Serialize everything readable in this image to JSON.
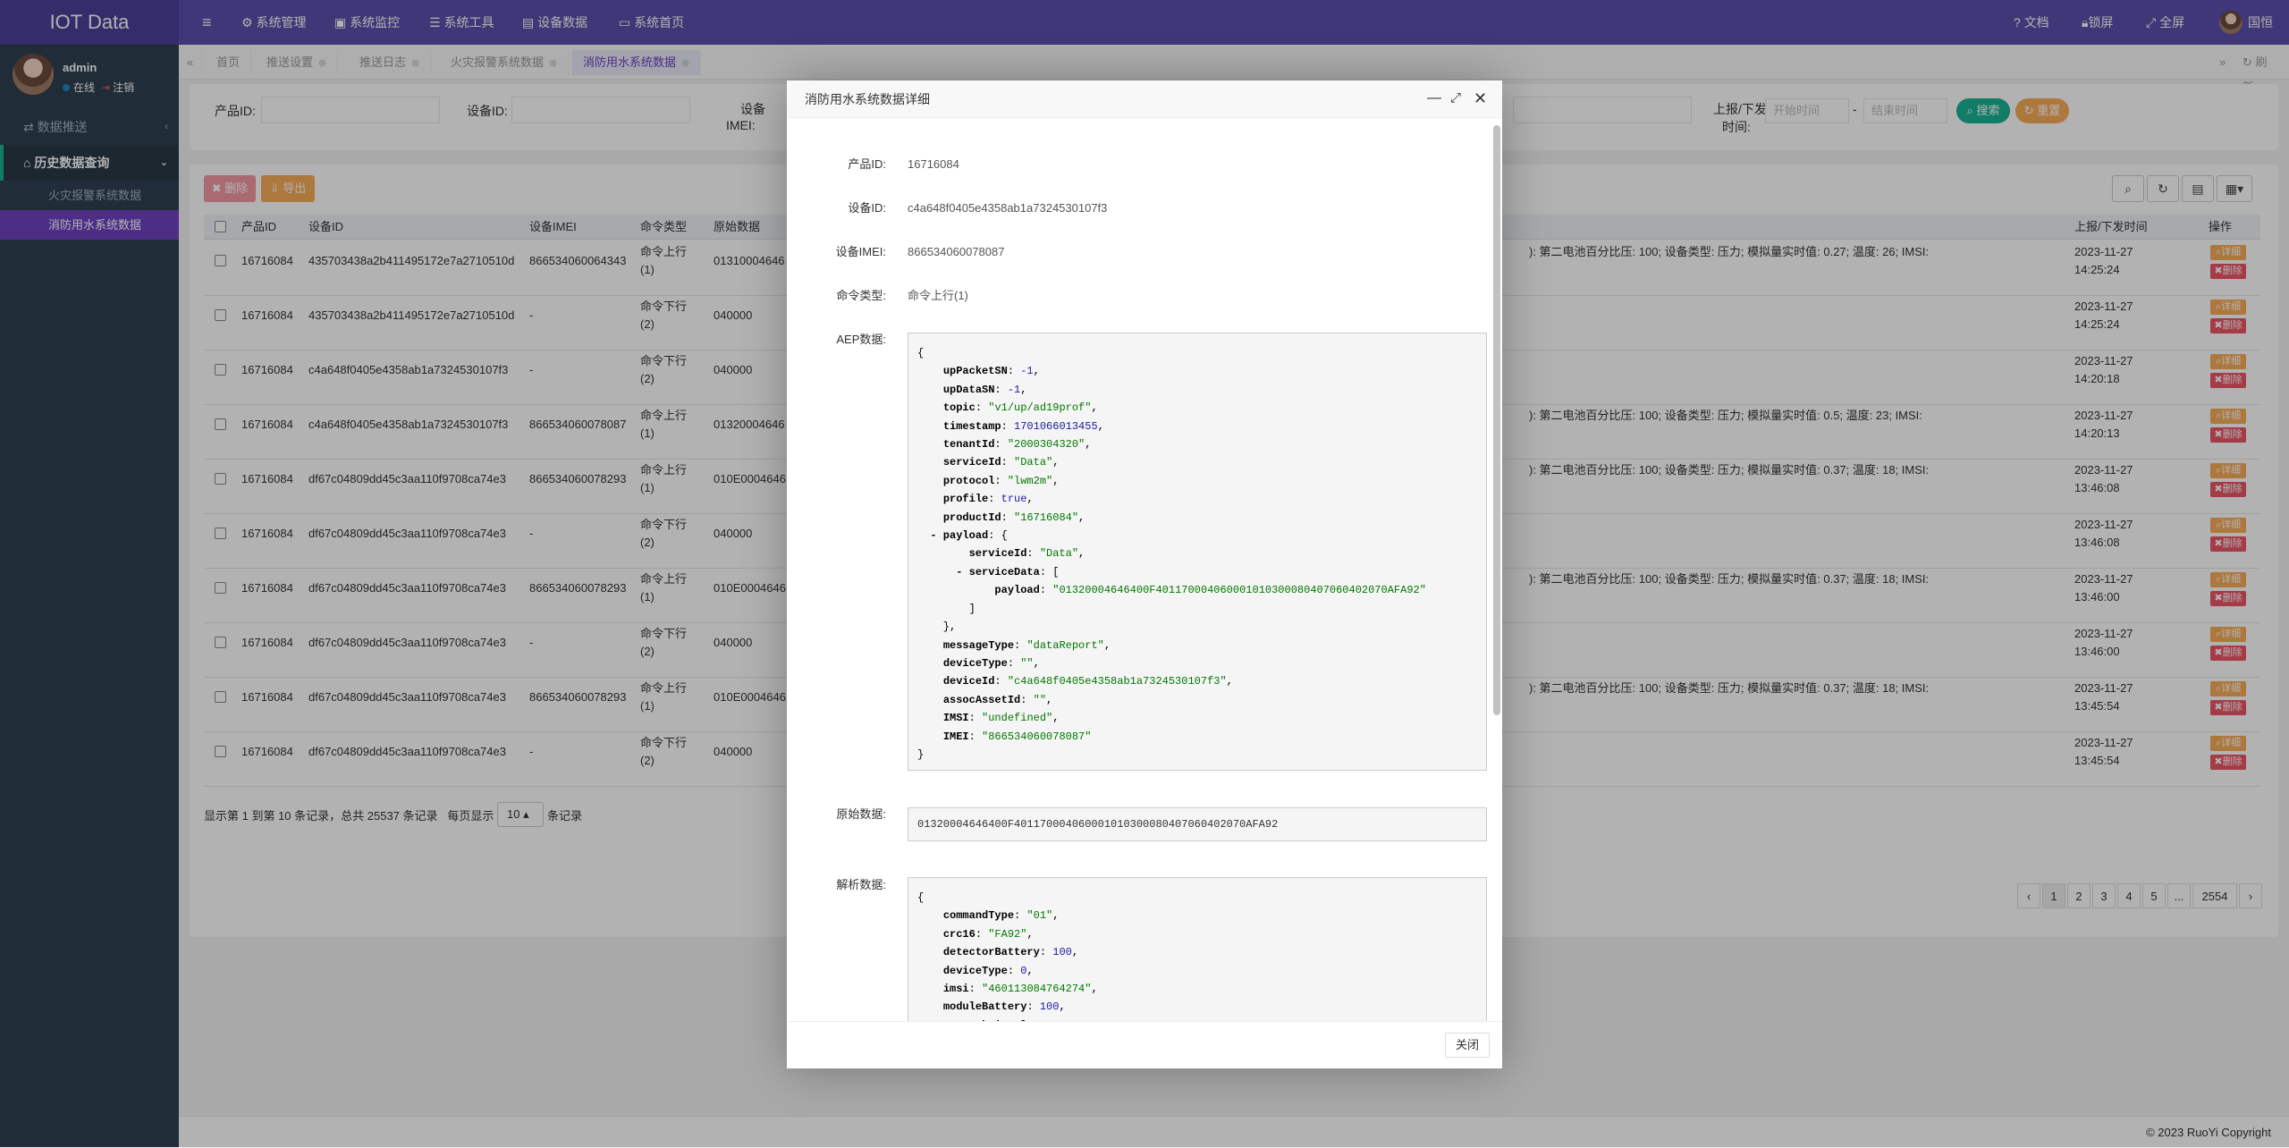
{
  "app": {
    "title": "IOT Data",
    "user": "admin",
    "status_online": "在线",
    "logout": "注销",
    "top_user": "国恒",
    "footer": "© 2023 RuoYi Copyright"
  },
  "topnav": [
    "系统管理",
    "系统监控",
    "系统工具",
    "设备数据",
    "系统首页"
  ],
  "topright": [
    "文档",
    "锁屏",
    "全屏"
  ],
  "sidebar": {
    "push": "数据推送",
    "history": "历史数据查询",
    "fire": "火灾报警系统数据",
    "water": "消防用水系统数据"
  },
  "tabs": [
    "首页",
    "推送设置",
    "推送日志",
    "火灾报警系统数据",
    "消防用水系统数据"
  ],
  "tabs_right": "刷新",
  "search": {
    "product": "产品ID:",
    "device": "设备ID:",
    "imei_1": "设备",
    "imei_2": "IMEI:",
    "time_1": "上报/下发",
    "time_2": "时间:",
    "start_ph": "开始时间",
    "end_ph": "结束时间",
    "dash": "-",
    "btn_search": "搜索",
    "btn_reset": "重置"
  },
  "toolbar": {
    "delete": "删除",
    "export": "导出"
  },
  "table": {
    "headers": [
      "产品ID",
      "设备ID",
      "设备IMEI",
      "命令类型",
      "原始数据",
      "上报/下发时间",
      "操作"
    ],
    "rows": [
      {
        "pid": "16716084",
        "did": "435703438a2b411495172e7a2710510d",
        "imei": "866534060064343",
        "cmd1": "命令上行",
        "cmd2": "(1)",
        "raw": "01310004646",
        "tail": "): 第二电池百分比压: 100; 设备类型: 压力; 模拟量实时值: 0.27; 温度: 26; IMSI:",
        "date": "2023-11-27",
        "time": "14:25:24"
      },
      {
        "pid": "16716084",
        "did": "435703438a2b411495172e7a2710510d",
        "imei": "-",
        "cmd1": "命令下行",
        "cmd2": "(2)",
        "raw": "040000",
        "tail": "",
        "date": "2023-11-27",
        "time": "14:25:24"
      },
      {
        "pid": "16716084",
        "did": "c4a648f0405e4358ab1a7324530107f3",
        "imei": "-",
        "cmd1": "命令下行",
        "cmd2": "(2)",
        "raw": "040000",
        "tail": "",
        "date": "2023-11-27",
        "time": "14:20:18"
      },
      {
        "pid": "16716084",
        "did": "c4a648f0405e4358ab1a7324530107f3",
        "imei": "866534060078087",
        "cmd1": "命令上行",
        "cmd2": "(1)",
        "raw": "01320004646",
        "tail": "): 第二电池百分比压: 100; 设备类型: 压力; 模拟量实时值: 0.5; 温度: 23; IMSI:",
        "date": "2023-11-27",
        "time": "14:20:13"
      },
      {
        "pid": "16716084",
        "did": "df67c04809dd45c3aa110f9708ca74e3",
        "imei": "866534060078293",
        "cmd1": "命令上行",
        "cmd2": "(1)",
        "raw": "010E0004646",
        "tail": "): 第二电池百分比压: 100; 设备类型: 压力; 模拟量实时值: 0.37; 温度: 18; IMSI:",
        "date": "2023-11-27",
        "time": "13:46:08"
      },
      {
        "pid": "16716084",
        "did": "df67c04809dd45c3aa110f9708ca74e3",
        "imei": "-",
        "cmd1": "命令下行",
        "cmd2": "(2)",
        "raw": "040000",
        "tail": "",
        "date": "2023-11-27",
        "time": "13:46:08"
      },
      {
        "pid": "16716084",
        "did": "df67c04809dd45c3aa110f9708ca74e3",
        "imei": "866534060078293",
        "cmd1": "命令上行",
        "cmd2": "(1)",
        "raw": "010E0004646",
        "tail": "): 第二电池百分比压: 100; 设备类型: 压力; 模拟量实时值: 0.37; 温度: 18; IMSI:",
        "date": "2023-11-27",
        "time": "13:46:00"
      },
      {
        "pid": "16716084",
        "did": "df67c04809dd45c3aa110f9708ca74e3",
        "imei": "-",
        "cmd1": "命令下行",
        "cmd2": "(2)",
        "raw": "040000",
        "tail": "",
        "date": "2023-11-27",
        "time": "13:46:00"
      },
      {
        "pid": "16716084",
        "did": "df67c04809dd45c3aa110f9708ca74e3",
        "imei": "866534060078293",
        "cmd1": "命令上行",
        "cmd2": "(1)",
        "raw": "010E0004646",
        "tail": "): 第二电池百分比压: 100; 设备类型: 压力; 模拟量实时值: 0.37; 温度: 18; IMSI:",
        "date": "2023-11-27",
        "time": "13:45:54"
      },
      {
        "pid": "16716084",
        "did": "df67c04809dd45c3aa110f9708ca74e3",
        "imei": "-",
        "cmd1": "命令下行",
        "cmd2": "(2)",
        "raw": "040000",
        "tail": "",
        "date": "2023-11-27",
        "time": "13:45:54"
      }
    ],
    "detail": "详细",
    "del": "删除"
  },
  "pager": {
    "summary": "显示第 1 到第 10 条记录，总共 25537 条记录",
    "per_page_pre": "每页显示",
    "per_page": "10",
    "per_page_post": "条记录",
    "pages": [
      "‹",
      "1",
      "2",
      "3",
      "4",
      "5",
      "...",
      "2554",
      "›"
    ]
  },
  "modal": {
    "title": "消防用水系统数据详细",
    "labels": {
      "product": "产品ID:",
      "device": "设备ID:",
      "imei": "设备IMEI:",
      "cmd": "命令类型:",
      "aep": "AEP数据:",
      "raw": "原始数据:",
      "parsed": "解析数据:"
    },
    "product": "16716084",
    "device": "c4a648f0405e4358ab1a7324530107f3",
    "imei": "866534060078087",
    "cmd": "命令上行(1)",
    "raw": "01320004646400F401170004060001010300080407060402070AFA92",
    "close": "关闭"
  }
}
